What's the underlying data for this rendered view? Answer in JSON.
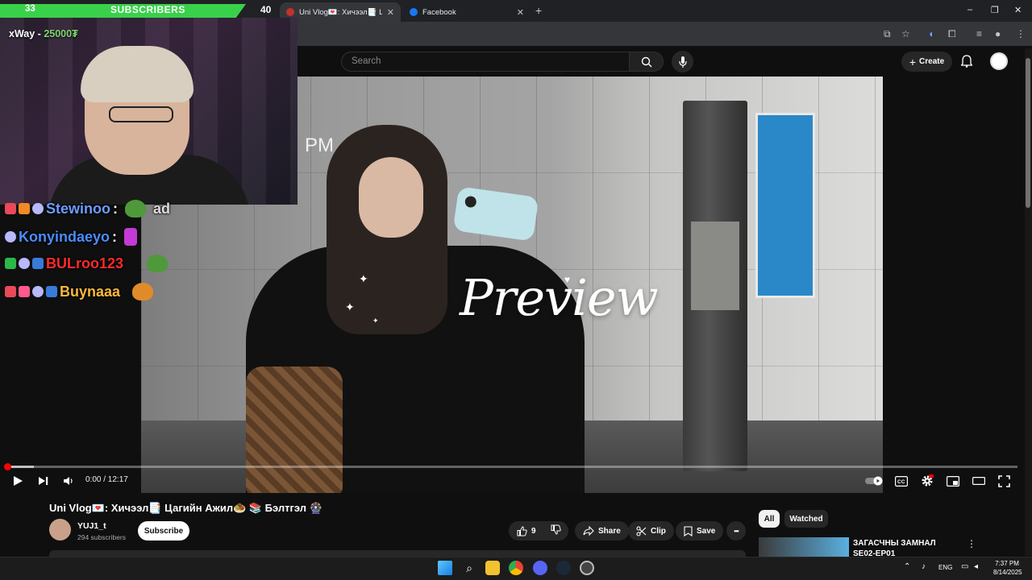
{
  "browser": {
    "tabs": [
      {
        "label": "Uni Vlog💌: Хичээл📑 Цагийн А",
        "close": "✕"
      },
      {
        "label": "Facebook",
        "close": "✕"
      }
    ],
    "new_tab": "+",
    "window_controls": {
      "minimize": "–",
      "restore": "❐",
      "close": "✕"
    }
  },
  "youtube": {
    "search_placeholder": "Search",
    "create_label": "Create"
  },
  "video": {
    "overlay_text": "Preview",
    "corner_text": "PM",
    "time": "0:00 / 12:17",
    "progress_fraction": 0.0,
    "buffer_fraction": 0.027
  },
  "stream_overlay": {
    "sub_left": "33",
    "sub_label": "SUBSCRIBERS",
    "sub_right": "40",
    "donation_user": "xWay",
    "donation_amount": "25000₮",
    "chat": [
      {
        "user": "Stewinoo",
        "color": "#6b9dff",
        "suffix": "ad"
      },
      {
        "user": "Konyindaeyo",
        "color": "#4a8cff",
        "suffix": ""
      },
      {
        "user": "BULroo123",
        "color": "#ff2a2a",
        "suffix": ""
      },
      {
        "user": "Buynaaa",
        "color": "#ffb93a",
        "suffix": ""
      }
    ]
  },
  "watch": {
    "title": "Uni Vlog💌: Хичээл📑 Цагийн Ажил🧆 📚 Бэлтгэл 🎡",
    "channel_name": "YUJ1_t",
    "channel_subs": "294 subscribers",
    "subscribe_label": "Subscribe",
    "like_count": "9",
    "share_label": "Share",
    "clip_label": "Clip",
    "save_label": "Save",
    "more_label": "•••"
  },
  "sidebar": {
    "chips": [
      "All",
      "Watched"
    ],
    "rec_title": "ЗАГАСЧНЫ ЗАМНАЛ SE02-EP01",
    "rec_more": "⋮"
  },
  "taskbar": {
    "lang": "ENG",
    "time": "7:37 PM",
    "date": "8/14/2025"
  },
  "colors": {
    "yt_bg": "#0f0f0f",
    "progress_red": "#ff0000",
    "sub_green": "#3ad14a"
  }
}
